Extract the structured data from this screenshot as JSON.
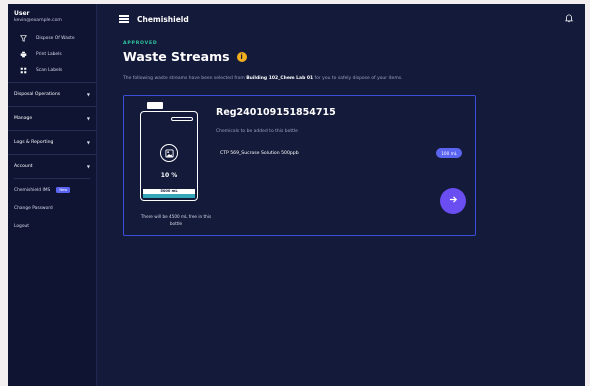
{
  "user": {
    "name": "User",
    "email": "kevin@example.com"
  },
  "sidebar": {
    "items": [
      {
        "label": "Dispose Of Waste",
        "icon": "filter-icon"
      },
      {
        "label": "Print Labels",
        "icon": "printer-icon"
      },
      {
        "label": "Scan Labels",
        "icon": "barcode-icon"
      }
    ],
    "sections": [
      {
        "label": "Disposal Operations"
      },
      {
        "label": "Manage"
      },
      {
        "label": "Logs & Reporting"
      },
      {
        "label": "Account"
      }
    ],
    "links": [
      {
        "label": "Chemishield IMS",
        "badge": "New"
      },
      {
        "label": "Change Password"
      },
      {
        "label": "Logout"
      }
    ]
  },
  "header": {
    "title": "Chemishield",
    "menu_icon": "hamburger-icon",
    "notify_icon": "bell-icon"
  },
  "page": {
    "status": "APPROVED",
    "title": "Waste Streams",
    "info_icon": "i",
    "desc_before": "The following waste streams have been selected from ",
    "desc_location": "Building 102_Chem Lab 01",
    "desc_after": " for you to safely dispose of your items."
  },
  "stream": {
    "id": "Reg240109151854715",
    "subtitle": "Chemicals to be added to this bottle",
    "chemical": "CTP 569_Sucrose Solution 500ppb",
    "amount": "100 mL",
    "fill_percent_label": "10 %",
    "fill_fraction": 0.1,
    "capacity_label": "5000 mL",
    "note": "There will be 4500 mL free in this bottle"
  },
  "colors": {
    "accent": "#5a64f0",
    "approved": "#2fc9a0",
    "info": "#f2b01e",
    "fill": "#36a7b8"
  }
}
